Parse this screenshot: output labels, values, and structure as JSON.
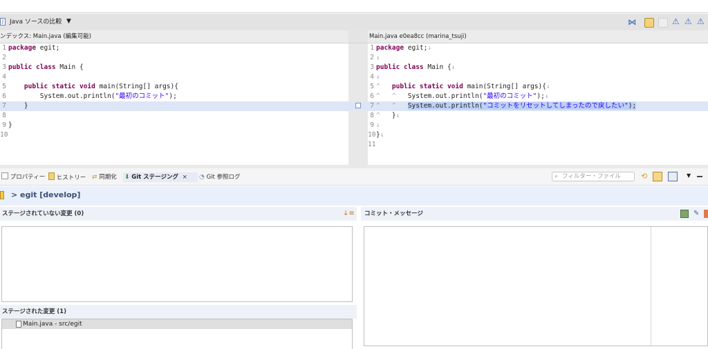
{
  "editor": {
    "title": "Java ソースの比較",
    "left_header": "ンデックス: Main.java (編集可能)",
    "right_header": "Main.java e0ea8cc (marina_tsuji)"
  },
  "left_code": [
    {
      "n": "1",
      "kw": "package",
      "rest": " egit;"
    },
    {
      "n": "2",
      "text": ""
    },
    {
      "n": "3",
      "kw": "public class",
      "rest": " Main {"
    },
    {
      "n": "4",
      "text": ""
    },
    {
      "n": "5",
      "indent": "    ",
      "kw": "public static void",
      "rest": " main(String[] args){"
    },
    {
      "n": "6",
      "indent": "        ",
      "pre": "System.out.println(",
      "str": "\"最初のコミット\"",
      "post": ");"
    },
    {
      "n": "7",
      "text": "    }"
    },
    {
      "n": "8",
      "text": ""
    },
    {
      "n": "9",
      "text": "}"
    },
    {
      "n": "10",
      "text": ""
    }
  ],
  "right_code": [
    {
      "n": "1",
      "kw": "package",
      "rest": " egit;",
      "ws": "↓"
    },
    {
      "n": "2",
      "ws": "↓"
    },
    {
      "n": "3",
      "kw": "public class",
      "rest": " Main {",
      "ws": "↓"
    },
    {
      "n": "4",
      "ws": "↓"
    },
    {
      "n": "5",
      "lead": "^   ",
      "kw": "public static void",
      "rest": " main(String[] args){",
      "ws": "↓"
    },
    {
      "n": "6",
      "lead": "^   ^   ",
      "pre": "System.out.println(",
      "str": "\"最初のコミット\"",
      "post": ");",
      "ws": "↓"
    },
    {
      "n": "7",
      "lead": "^   ^   ",
      "pre": "System.out.println(",
      "str": "\"コミットをリセットしてしまったので戻したい\"",
      "post": ");"
    },
    {
      "n": "8",
      "lead": "^   ",
      "text": "}",
      "ws": "↓"
    },
    {
      "n": "9",
      "ws": "↓"
    },
    {
      "n": "10",
      "text": "}",
      "ws": "↓"
    },
    {
      "n": "11"
    }
  ],
  "tabs": [
    {
      "label": "プロパティー"
    },
    {
      "label": "ヒストリー"
    },
    {
      "label": "同期化"
    },
    {
      "label": "Git ステージング"
    },
    {
      "label": "Git 参照ログ"
    }
  ],
  "filter": {
    "placeholder": "フィルター・ファイル"
  },
  "repo": {
    "label": "> egit [develop]"
  },
  "unstaged": {
    "title": "ステージされていない変更 (0)"
  },
  "staged": {
    "title": "ステージされた変更 (1)",
    "items": [
      {
        "label": "Main.java - src/egit"
      }
    ]
  },
  "commit": {
    "title": "コミット・メッセージ"
  },
  "colors": {
    "highlight": "#dce6f7",
    "selected": "#bcd0f5",
    "kw": "#7f0055",
    "string": "#2a00ff"
  }
}
